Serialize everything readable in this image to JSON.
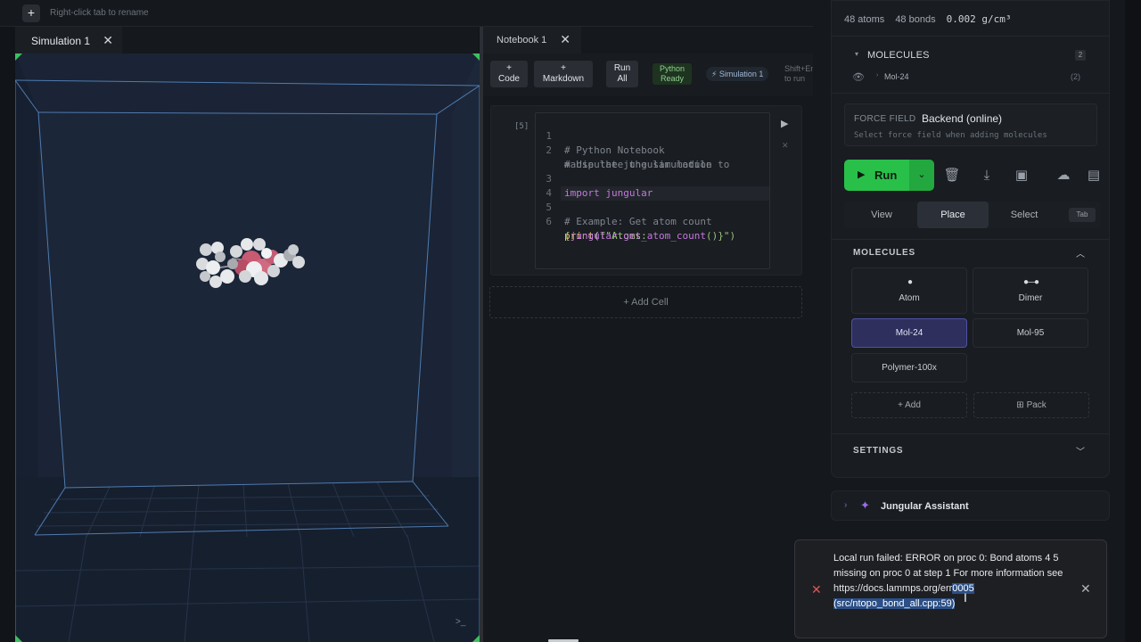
{
  "topbar": {
    "add_tab_label": "+",
    "rename_hint": "Right-click tab to rename"
  },
  "simulation": {
    "tab_label": "Simulation 1",
    "close_glyph": "✕",
    "corner_icon": "terminal-icon"
  },
  "notebook": {
    "tab_label": "Notebook 1",
    "close_glyph": "✕",
    "toolbar": {
      "code_line1": "+",
      "code_line2": "Code",
      "markdown_line1": "+",
      "markdown_line2": "Markdown",
      "runall_line1": "Run",
      "runall_line2": "All",
      "status_line1": "Python",
      "status_line2": "Ready",
      "sim_badge": "⚡ Simulation 1",
      "shortcut_line1": "Shift+Enter",
      "shortcut_line2": "to run"
    },
    "cell": {
      "exec_count": "[5]",
      "line_numbers": [
        "1",
        "2",
        "3",
        "4",
        "5",
        "6"
      ],
      "code": {
        "l1": "# Python Notebook",
        "l2a": "# Use the jungular module to",
        "l2b": "manipulate the simulation",
        "l3_kw": "import",
        "l3_mod": " jungular",
        "l5": "# Example: Get atom count",
        "l6_fn": "print",
        "l6_paren": "(",
        "l6_str": "f\"Atoms:",
        "l6b_open": "{",
        "l6b_call": "jungular.get_atom_count",
        "l6b_close": "()}\")"
      }
    },
    "add_cell_label": "+ Add Cell"
  },
  "panel": {
    "stats": {
      "atoms": "48 atoms",
      "bonds": "48 bonds",
      "density": "0.002 g/cm³"
    },
    "molecules_list": {
      "header": "MOLECULES",
      "count": "2",
      "items": [
        {
          "name": "Mol-24",
          "count": "(2)"
        }
      ]
    },
    "force_field": {
      "label": "FORCE FIELD",
      "value": "Backend (online)",
      "hint": "Select force field when adding molecules"
    },
    "run_label": "Run",
    "modes": [
      "View",
      "Place",
      "Select"
    ],
    "active_mode": "Place",
    "tab_key": "Tab",
    "molecules_section": {
      "title": "MOLECULES",
      "cards": [
        {
          "glyph": "●",
          "name": "Atom"
        },
        {
          "glyph": "●—●",
          "name": "Dimer"
        },
        {
          "name": "Mol-24",
          "selected": true
        },
        {
          "name": "Mol-95"
        },
        {
          "name": "Polymer-100x"
        }
      ],
      "add_label": "+ Add",
      "pack_label": "Pack"
    },
    "settings_label": "SETTINGS",
    "assistant_label": "Jungular Assistant"
  },
  "toast": {
    "msg_part1": "Local run failed: ERROR on proc 0: Bond atoms 4 5 missing on proc 0 at step 1 For more information see https://docs.lammps.org/err",
    "msg_selected": "0005 (src/ntopo_bond_all.cpp:59)"
  },
  "colors": {
    "accent_green": "#29c04a",
    "selected_card": "#2e2f5c",
    "error_red": "#e05555",
    "assistant_purple": "#9b6cf0"
  }
}
